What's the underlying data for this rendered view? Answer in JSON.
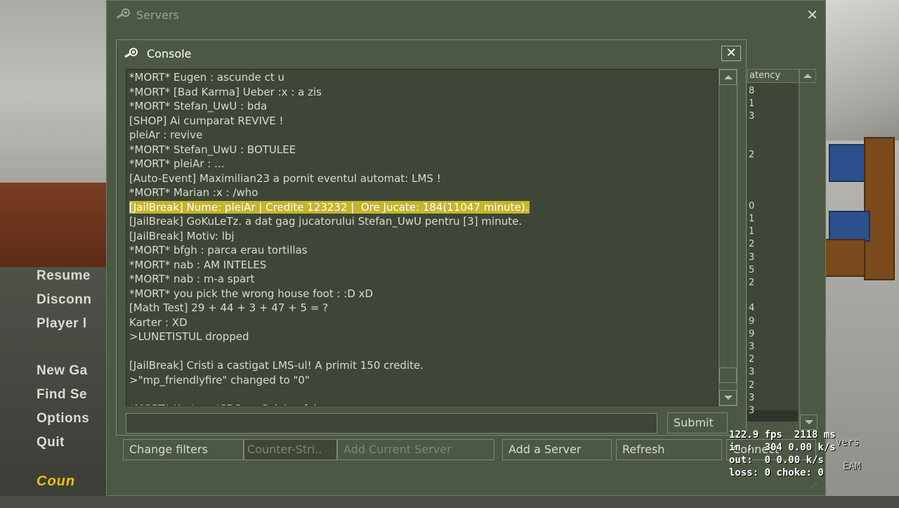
{
  "main_menu": {
    "items": [
      "Resume",
      "Disconn",
      "Player l",
      "New Ga",
      "Find Se",
      "Options",
      "Quit"
    ],
    "logo_text": "Coun"
  },
  "servers_window": {
    "title": "Servers",
    "close_glyph": "✕",
    "latency_header": "atency",
    "latency_values": [
      "8",
      "1",
      "3",
      "",
      "",
      "2",
      "",
      "",
      "",
      "0",
      "1",
      "1",
      "2",
      "3",
      "5",
      "2",
      "",
      "4",
      "9",
      "9",
      "3",
      "2",
      "3",
      "2",
      "3",
      "3"
    ],
    "bottom_bar": {
      "change_filters": "Change filters",
      "game_filter": "Counter-Stri..",
      "add_current_server": "Add Current Server",
      "add_server": "Add a Server",
      "refresh": "Refresh",
      "connect": "Connect"
    }
  },
  "console": {
    "title": "Console",
    "close_glyph": "✕",
    "lines": [
      "*MORT* Eugen : ascunde ct u",
      "*MORT* [Bad Karma] Ueber :x : a zis",
      "*MORT* Stefan_UwU : bda",
      "[SHOP] Ai cumparat REVIVE !",
      "pleiAr : revive",
      "*MORT* Stefan_UwU : BOTULEE",
      "*MORT* pleiAr : ...",
      "[Auto-Event] Maximilian23 a pornit eventul automat: LMS !",
      "*MORT* Marian :x : /who",
      "[JailBreak] Nume: pleiAr | Credite 123232 |  Ore Jucate: 184(11047 minute).",
      "[JailBreak] GoKuLeTz. a dat gag jucatorului Stefan_UwU pentru [3] minute.",
      "[JailBreak] Motiv: lbj",
      "*MORT* bfgh : parca erau tortillas",
      "*MORT* nab : AM INTELES",
      "*MORT* nab : m-a spart",
      "*MORT* you pick the wrong house foot : :D xD",
      "[Math Test] 29 + 44 + 3 + 47 + 5 = ?",
      "Karter : XD",
      ">LUNETISTUL dropped",
      "",
      "[JailBreak] Cristi a castigat LMS-ul! A primit 150 credite.",
      ">\"mp_friendlyfire\" changed to \"0\"",
      "",
      "*MORT* Karter : 'CDS :... Solving fal..."
    ],
    "highlight_line_index": 9,
    "input_value": "",
    "submit_label": "Submit"
  },
  "net_graph": {
    "line1": "122.9 fps  2118 ms",
    "line2": "in :  304 0.00 k/s",
    "line3": "out:  0 0.00 k/s",
    "line4": "loss: 0 choke: 0",
    "overlay_right": "vers",
    "overlay_right2": "EAM"
  },
  "colors": {
    "panel": "#4c5844",
    "panel_dark": "#3e4637",
    "text": "#d8dccd",
    "highlight": "#c4b52c",
    "logo": "#f0c200"
  }
}
